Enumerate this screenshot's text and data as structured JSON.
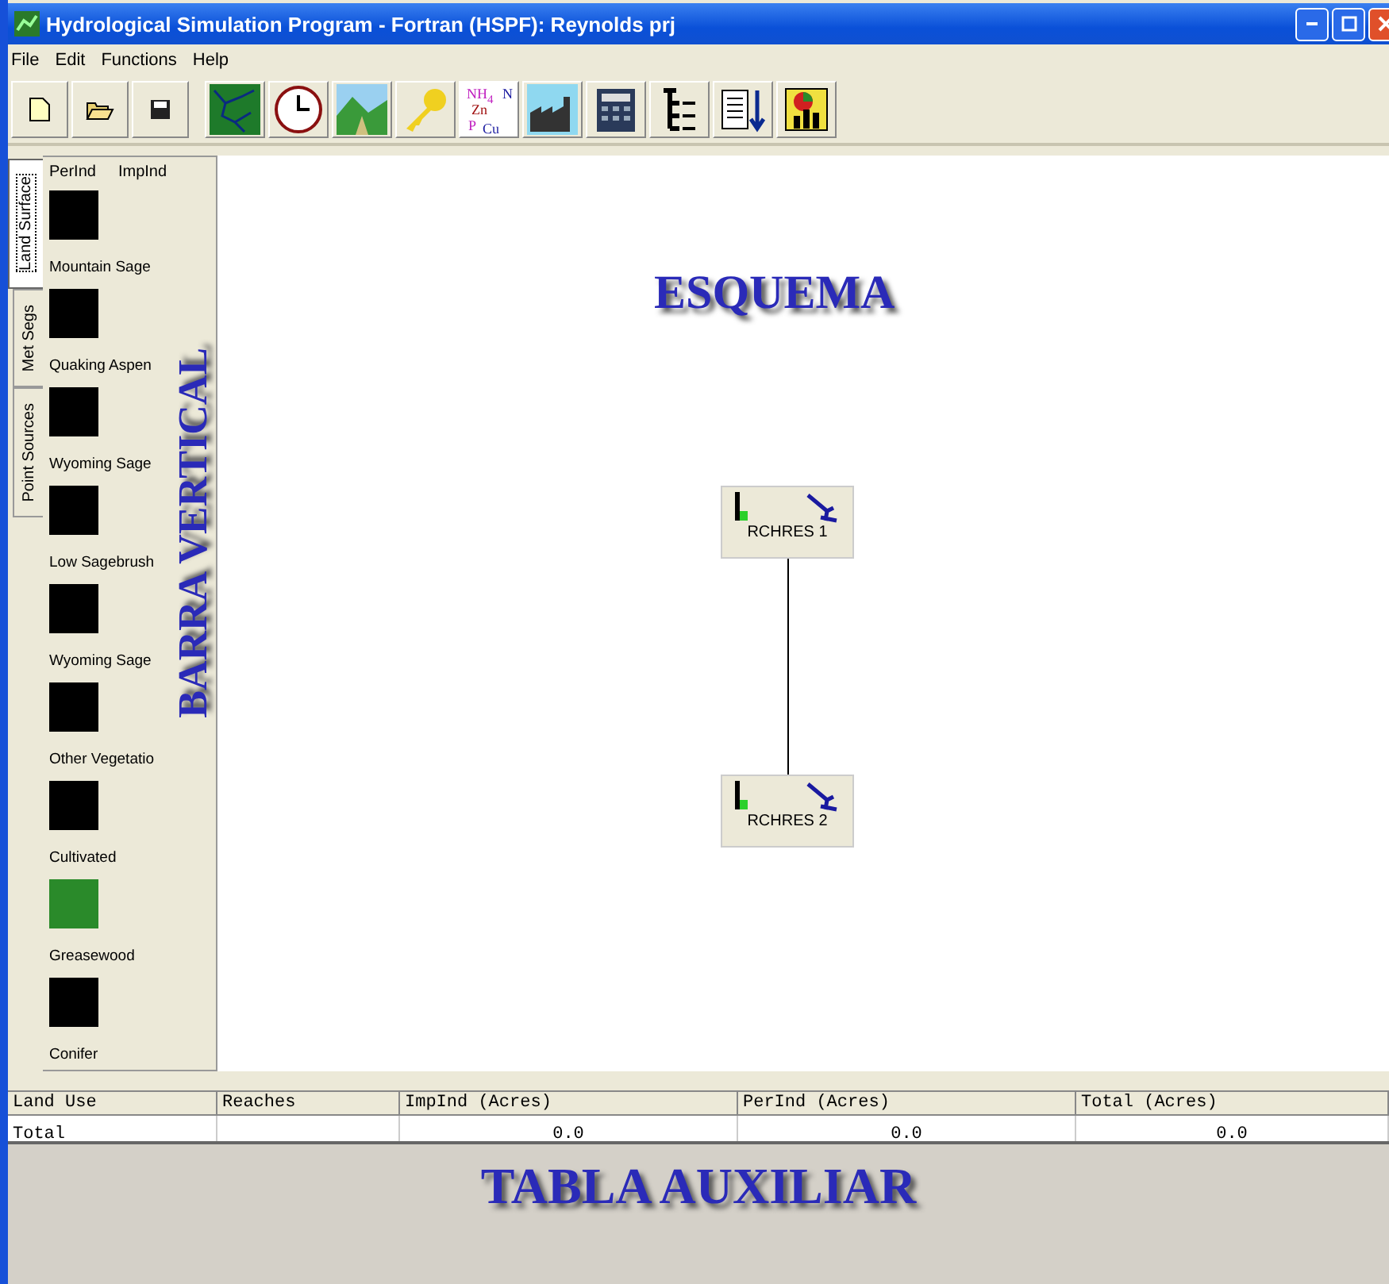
{
  "window": {
    "title": "Hydrological Simulation Program - Fortran (HSPF): Reynolds prj"
  },
  "menu": [
    "File",
    "Edit",
    "Functions",
    "Help"
  ],
  "toolbar": {
    "constituent_labels": [
      "NH$_{4}$",
      "N",
      "Zn",
      "P",
      "Cu"
    ]
  },
  "side_tabs": [
    {
      "label": "Land Surface",
      "selected": true
    },
    {
      "label": "Met Segs",
      "selected": false
    },
    {
      "label": "Point Sources",
      "selected": false
    }
  ],
  "land_use_header": [
    "PerInd",
    "ImpInd"
  ],
  "land_uses": [
    {
      "name": "Mountain Sage",
      "color": "#000000"
    },
    {
      "name": "Quaking Aspen",
      "color": "#000000"
    },
    {
      "name": "Wyoming Sage",
      "color": "#000000"
    },
    {
      "name": "Low Sagebrush",
      "color": "#000000"
    },
    {
      "name": "Wyoming Sage",
      "color": "#000000"
    },
    {
      "name": "Other Vegetatio",
      "color": "#000000"
    },
    {
      "name": "Cultivated",
      "color": "#000000"
    },
    {
      "name": "Greasewood",
      "color": "#2a8a2a"
    },
    {
      "name": "Conifer",
      "color": "#000000"
    }
  ],
  "overlay_labels": {
    "canvas": "ESQUEMA",
    "sidebar": "BARRA VERTICAL",
    "table": "TABLA AUXILIAR"
  },
  "nodes": [
    {
      "label": "RCHRES 1"
    },
    {
      "label": "RCHRES 2"
    }
  ],
  "table": {
    "columns": [
      "Land Use",
      "Reaches",
      "ImpInd (Acres)",
      "PerInd (Acres)",
      "Total (Acres)"
    ],
    "rows": [
      [
        "Total",
        "",
        "0.0",
        "0.0",
        "0.0"
      ]
    ]
  }
}
